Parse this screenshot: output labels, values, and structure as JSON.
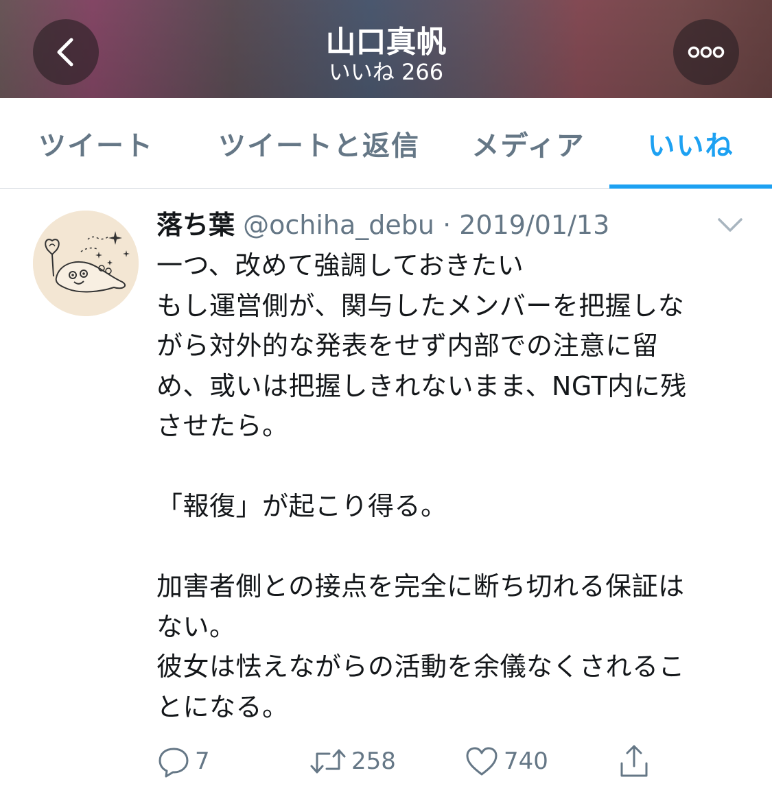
{
  "header": {
    "title": "山口真帆",
    "subtitle": "いいね 266",
    "back_icon": "chevron-left-icon",
    "more_icon": "more-horizontal-icon"
  },
  "tabs": [
    {
      "label": "ツイート",
      "active": false
    },
    {
      "label": "ツイートと返信",
      "active": false
    },
    {
      "label": "メディア",
      "active": false
    },
    {
      "label": "いいね",
      "active": true
    }
  ],
  "tweet": {
    "author_name": "落ち葉",
    "handle": "@ochiha_debu",
    "separator": "·",
    "date": "2019/01/13",
    "text": "一つ、改めて強調しておきたい\nもし運営側が、関与したメンバーを把握しな\nがら対外的な発表をせず内部での注意に留\nめ、或いは把握しきれないまま、NGT内に残\nさせたら。\n\n「報復」が起こり得る。\n\n加害者側との接点を完全に断ち切れる保証は\nない。\n彼女は怯えながらの活動を余儀なくされるこ\nとになる。",
    "reply_count": "7",
    "retweet_count": "258",
    "like_count": "740"
  },
  "colors": {
    "accent": "#1da1f2",
    "muted": "#657786",
    "text": "#14171a"
  }
}
